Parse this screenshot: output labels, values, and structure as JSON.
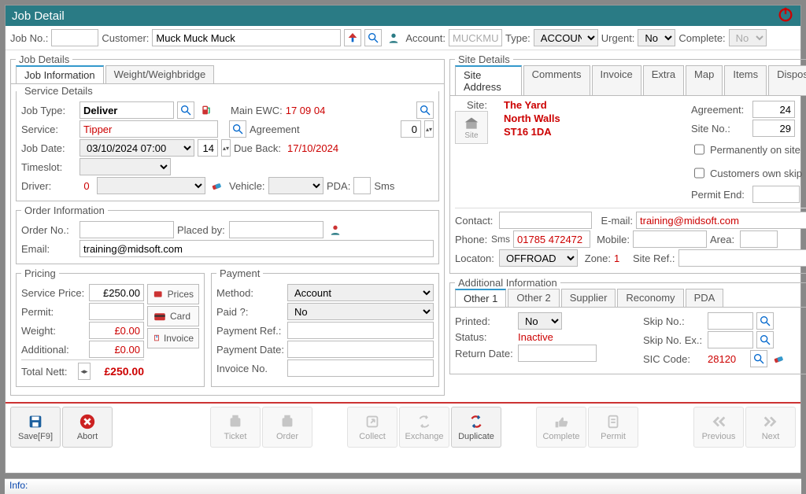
{
  "window": {
    "title": "Job Detail",
    "info": "Info:"
  },
  "topbar": {
    "job_no_lbl": "Job No.:",
    "job_no": "",
    "customer_lbl": "Customer:",
    "customer": "Muck Muck Muck",
    "account_lbl": "Account:",
    "account": "MUCKMU",
    "type_lbl": "Type:",
    "type": "ACCOUNT",
    "urgent_lbl": "Urgent:",
    "urgent": "No",
    "complete_lbl": "Complete:",
    "complete": "No"
  },
  "job_details": {
    "legend": "Job Details",
    "tabs": [
      "Job Information",
      "Weight/Weighbridge"
    ],
    "service_legend": "Service Details",
    "job_type_lbl": "Job Type:",
    "job_type": "Deliver",
    "main_ewc_lbl": "Main EWC:",
    "main_ewc": "17 09 04",
    "service_lbl": "Service:",
    "service": "Tipper",
    "agreement_lbl": "Agreement",
    "agreement_qty": "0",
    "job_date_lbl": "Job Date:",
    "job_date": "03/10/2024 07:00",
    "job_date_qty": "14",
    "due_back_lbl": "Due Back:",
    "due_back": "17/10/2024",
    "timeslot_lbl": "Timeslot:",
    "timeslot": "",
    "driver_lbl": "Driver:",
    "driver": "0",
    "driver_name": "",
    "vehicle_lbl": "Vehicle:",
    "vehicle": "",
    "pda_lbl": "PDA:",
    "sms_lbl": "Sms",
    "order_legend": "Order Information",
    "order_no_lbl": "Order No.:",
    "order_no": "",
    "placed_by_lbl": "Placed by:",
    "placed_by": "",
    "email_lbl": "Email:",
    "email": "training@midsoft.com",
    "pricing_legend": "Pricing",
    "service_price_lbl": "Service Price:",
    "service_price": "£250.00",
    "permit_lbl": "Permit:",
    "permit": "",
    "weight_lbl": "Weight:",
    "weight": "£0.00",
    "additional_lbl": "Additional:",
    "additional": "£0.00",
    "total_lbl": "Total Nett:",
    "total": "£250.00",
    "prices_btn": "Prices",
    "card_btn": "Card",
    "invoice_btn": "Invoice",
    "payment_legend": "Payment",
    "method_lbl": "Method:",
    "method": "Account",
    "paid_lbl": "Paid ?:",
    "paid": "No",
    "payref_lbl": "Payment Ref.:",
    "payref": "",
    "paydate_lbl": "Payment Date:",
    "paydate": "",
    "invno_lbl": "Invoice No.",
    "invno": ""
  },
  "site_details": {
    "legend": "Site Details",
    "tabs": [
      "Site Address",
      "Comments",
      "Invoice",
      "Extra",
      "Map",
      "Items",
      "Disposal"
    ],
    "site_lbl": "Site:",
    "site_icon": "Site",
    "site_line1": "The Yard",
    "site_line2": "North Walls",
    "site_line3": "ST16 1DA",
    "agreement_lbl": "Agreement:",
    "agreement": "24",
    "siteno_lbl": "Site No.:",
    "siteno": "29",
    "perm_lbl": "Permanently on site",
    "ownskip_lbl": "Customers own skip",
    "permitend_lbl": "Permit End:",
    "permitend": "",
    "contact_lbl": "Contact:",
    "contact": "",
    "email_lbl": "E-mail:",
    "email": "training@midsoft.com",
    "phone_lbl": "Phone:",
    "phone_sms": "Sms",
    "phone": "01785 472472",
    "mobile_lbl": "Mobile:",
    "mobile": "",
    "area_lbl": "Area:",
    "area": "",
    "locaton_lbl": "Locaton:",
    "locaton": "OFFROAD",
    "zone_lbl": "Zone:",
    "zone": "1",
    "siteref_lbl": "Site Ref.:",
    "siteref": ""
  },
  "additional": {
    "legend": "Additional Information",
    "tabs": [
      "Other 1",
      "Other 2",
      "Supplier",
      "Reconomy",
      "PDA"
    ],
    "printed_lbl": "Printed:",
    "printed": "No",
    "status_lbl": "Status:",
    "status": "Inactive",
    "return_lbl": "Return Date:",
    "return": "",
    "skipno_lbl": "Skip No.:",
    "skipno": "",
    "skipex_lbl": "Skip No. Ex.:",
    "skipex": "",
    "sic_lbl": "SIC Code:",
    "sic": "28120"
  },
  "buttons": {
    "save": "Save[F9]",
    "abort": "Abort",
    "ticket": "Ticket",
    "order": "Order",
    "collect": "Collect",
    "exchange": "Exchange",
    "duplicate": "Duplicate",
    "complete": "Complete",
    "permit": "Permit",
    "previous": "Previous",
    "next": "Next"
  }
}
